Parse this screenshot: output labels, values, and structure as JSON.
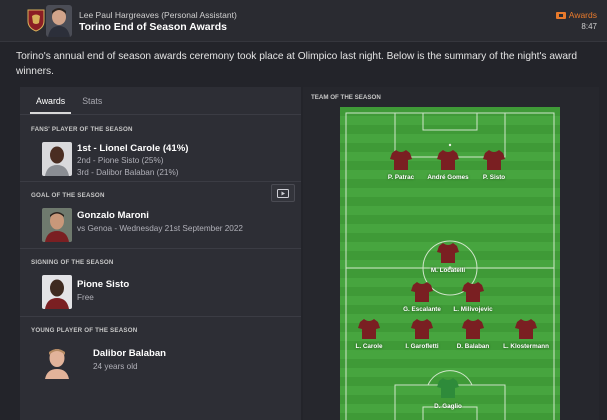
{
  "header": {
    "sender": "Lee Paul Hargreaves  (Personal Assistant)",
    "subject": "Torino End of Season Awards",
    "tag": "Awards",
    "time": "8:47",
    "accent": "#e87a2c"
  },
  "message": "Torino's annual end of season awards ceremony took place at Olimpico last night. Below is the summary of the night's award winners.",
  "tabs": [
    "Awards",
    "Stats"
  ],
  "awards": {
    "fans_title": "FANS' PLAYER OF THE SEASON",
    "fans_first": "1st - Lionel Carole (41%)",
    "fans_second": "2nd - Pione Sisto (25%)",
    "fans_third": "3rd - Dalibor Balaban (21%)",
    "goal_title": "GOAL OF THE SEASON",
    "goal_name": "Gonzalo Maroni",
    "goal_detail": "vs Genoa - Wednesday 21st September 2022",
    "signing_title": "SIGNING OF THE SEASON",
    "signing_name": "Pione Sisto",
    "signing_detail": "Free",
    "young_title": "YOUNG PLAYER OF THE SEASON",
    "young_name": "Dalibor Balaban",
    "young_detail": "24 years old"
  },
  "team_of_season": {
    "title": "TEAM OF THE SEASON",
    "players": [
      "P. Patrac",
      "André Gomes",
      "P. Sisto",
      "M. Locatelli",
      "G. Escalante",
      "L. Milivojevic",
      "L. Carole",
      "I. Garofletti",
      "D. Balaban",
      "L. Klostermann",
      "D. Gaglio"
    ],
    "shirt_color": "#7a1f22",
    "keeper_color": "#2e8b3a"
  }
}
